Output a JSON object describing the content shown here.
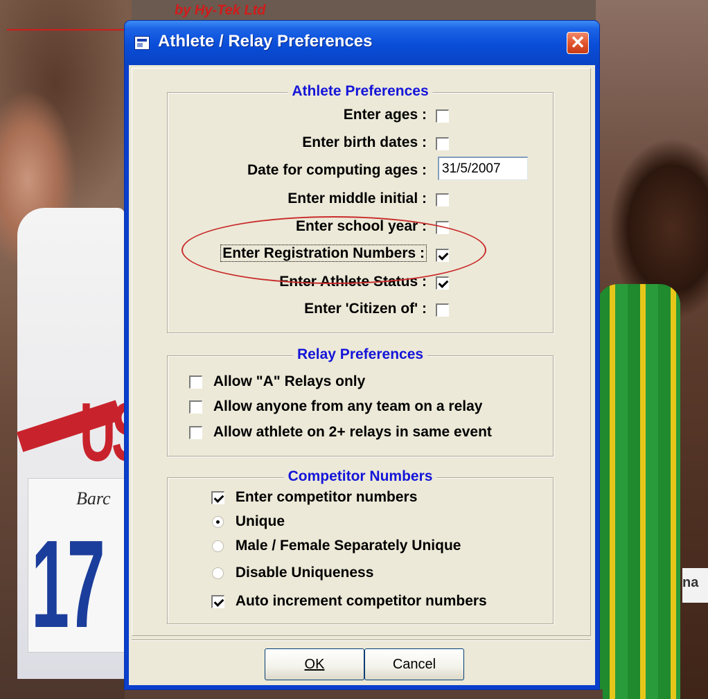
{
  "window": {
    "title": "Athlete / Relay Preferences",
    "close_label": "✕",
    "background_red_text": "by Hy-Tek Ltd"
  },
  "athlete": {
    "title": "Athlete Preferences",
    "enter_ages": "Enter ages :",
    "enter_birth_dates": "Enter birth dates :",
    "date_for_ages": "Date for computing ages :",
    "date_value": "31/5/2007",
    "enter_middle_initial": "Enter middle initial :",
    "enter_school_year": "Enter school year :",
    "enter_registration": "Enter Registration Numbers :",
    "enter_athlete_status": "Enter Athlete Status :",
    "enter_citizen": "Enter 'Citizen of' :"
  },
  "relay": {
    "title": "Relay Preferences",
    "allow_a_only": "Allow \"A\" Relays only",
    "allow_anyone": "Allow anyone from any team on a relay",
    "allow_athlete_2plus": "Allow athlete on 2+ relays in same event"
  },
  "competitor": {
    "title": "Competitor Numbers",
    "enter_numbers": "Enter competitor numbers",
    "unique": "Unique",
    "male_female": "Male / Female Separately Unique",
    "disable": "Disable Uniqueness",
    "auto_increment": "Auto increment competitor numbers"
  },
  "buttons": {
    "ok": "OK",
    "cancel": "Cancel"
  },
  "background": {
    "jersey_text": "US",
    "bib_number": "17",
    "bib_brand": "Barc",
    "right_label": "na"
  },
  "colors": {
    "group_title": "#1515d9",
    "highlight_ellipse": "#c92a2a",
    "titlebar": "#0a4dd8"
  }
}
